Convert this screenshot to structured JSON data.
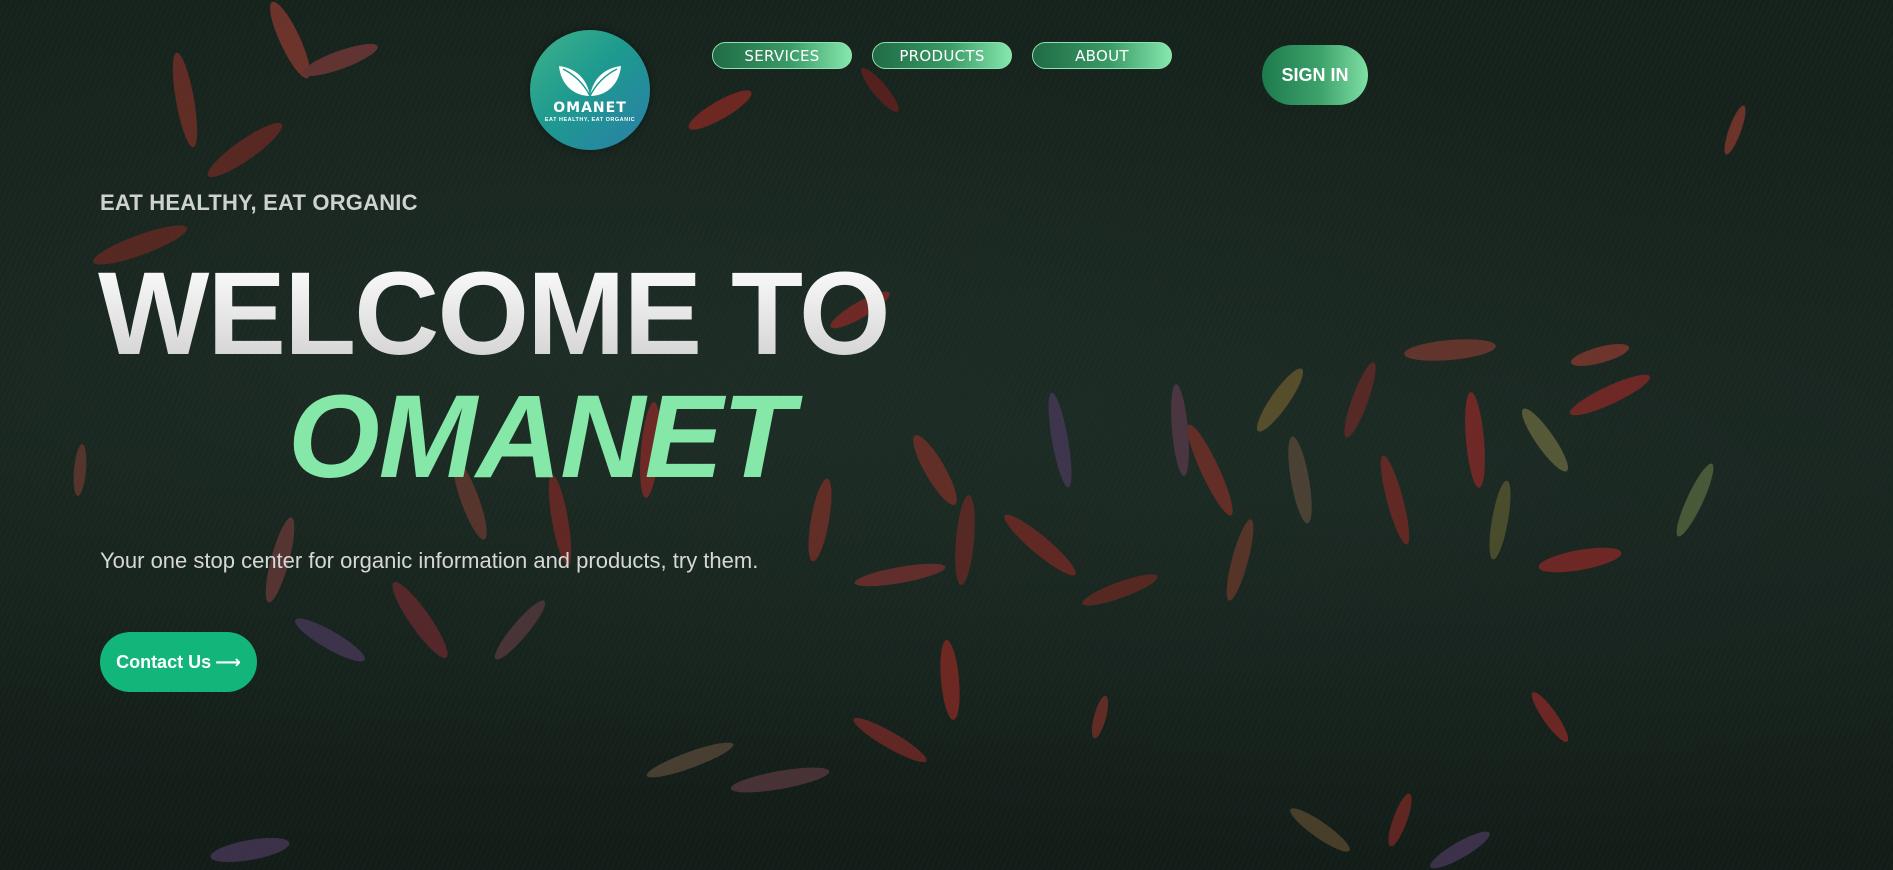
{
  "brand": {
    "logo_name": "OMANET",
    "logo_tagline": "EAT HEALTHY, EAT ORGANIC"
  },
  "nav": {
    "items": [
      {
        "label": "SERVICES"
      },
      {
        "label": "PRODUCTS"
      },
      {
        "label": "ABOUT"
      }
    ],
    "signin_label": "SIGN IN"
  },
  "hero": {
    "tagline": "EAT HEALTHY, EAT ORGANIC",
    "welcome": "WELCOME TO",
    "brand_name": "OMANET",
    "description": "Your one stop center for organic information and products, try them.",
    "cta_label": "Contact Us",
    "cta_arrow": "⟶"
  },
  "colors": {
    "accent_green": "#86e8a8",
    "cta_green": "#12b67a",
    "background": "#142019"
  }
}
